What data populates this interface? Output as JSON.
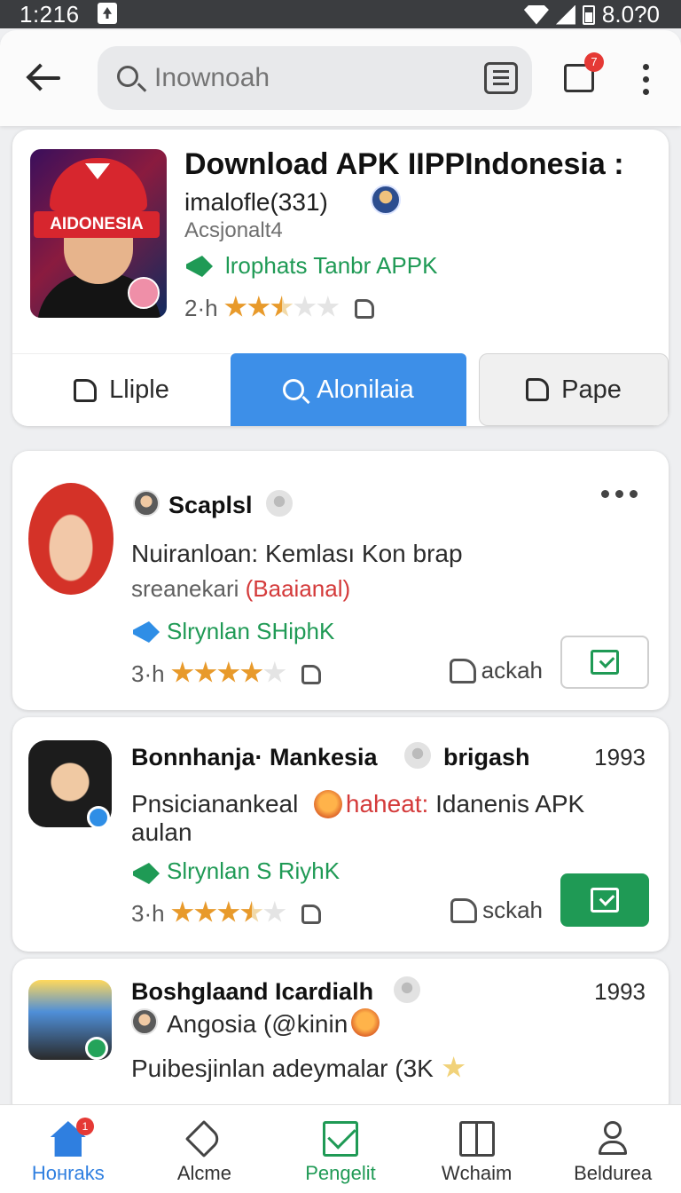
{
  "status_bar": {
    "time": "1:216",
    "battery": "8.0?0"
  },
  "app_bar": {
    "search_placeholder": "Inownoah",
    "notification_count": "7"
  },
  "hero": {
    "title": "Download APK IIPPIndonesia :",
    "subtitle": "imalofle(331)",
    "meta": "Acsjonalt4",
    "tag": "lrophats Tanbr APPK",
    "age": "2·h",
    "thumb_text": "AIDONESIA",
    "rating": 2.5,
    "buttons": {
      "like": "Lliple",
      "primary": "Alonilaia",
      "page": "Pape"
    }
  },
  "posts": [
    {
      "name": "Scaplsl",
      "text": "Nuiranloan: Kemlası Kon brap",
      "sub_prefix": "sreanekari",
      "sub_highlight": "(Baaianal)",
      "tag": "Slrynlan SHiphK",
      "age": "3·h",
      "rating": 4,
      "save_label": "ackah"
    },
    {
      "name": "Bonnhanja· Mankesia",
      "name_suffix": "brigash",
      "year": "1993",
      "text_prefix": "Pnsicianankeal",
      "text_highlight": "haheat:",
      "text_suffix": "Idanenis APK",
      "text_line2": "aulan",
      "tag": "Slrynlan S RiyhK",
      "age": "3·h",
      "rating": 3.5,
      "save_label": "sckah"
    },
    {
      "name": "Boshglaand Icardialh",
      "year": "1993",
      "line1": "Angosia (@kinin",
      "line2": "Puibesjinlan adeymalar (3K"
    }
  ],
  "bottom_nav": [
    {
      "label": "Hoнraks",
      "badge": "1"
    },
    {
      "label": "Alcme"
    },
    {
      "label": "Pengelit"
    },
    {
      "label": "Wchaim"
    },
    {
      "label": "Beldurea"
    }
  ],
  "colors": {
    "primary": "#3d8fe8",
    "accent_green": "#1f9a55",
    "alert_red": "#e53935"
  }
}
